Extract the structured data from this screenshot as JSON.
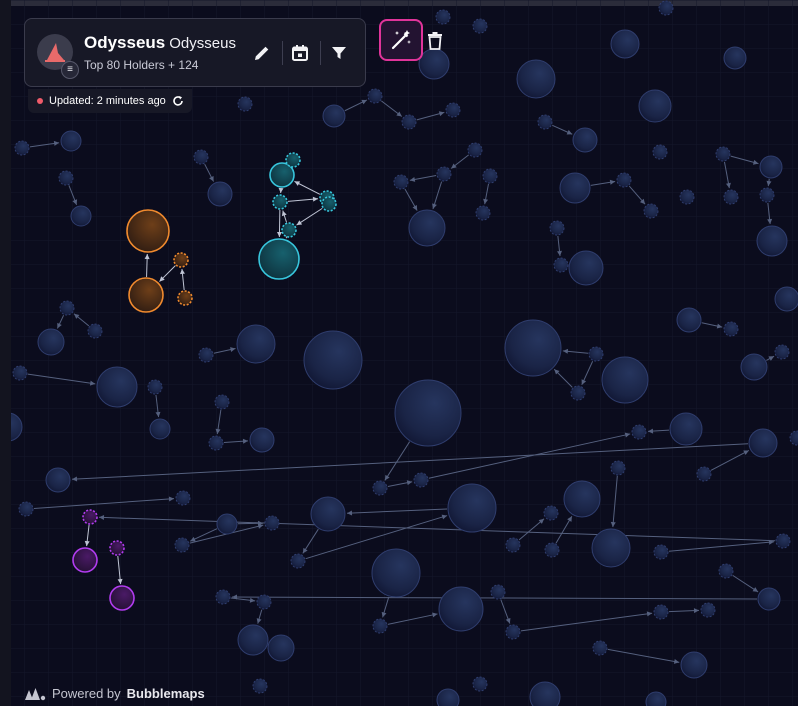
{
  "token": {
    "name": "Odysseus",
    "symbol": "Odysseus",
    "subtitle": "Top 80 Holders + 124",
    "logo_color": "#e86a6a"
  },
  "chain_icon": "solana-icon",
  "status": {
    "updated_text": "Updated: 2 minutes ago",
    "dot_color": "#ef5b6a"
  },
  "toolbar": {
    "edit_icon": "pencil-icon",
    "calendar_icon": "calendar-icon",
    "filter_icon": "filter-icon",
    "magic_icon": "magic-wand-icon",
    "delete_icon": "trash-icon"
  },
  "footer": {
    "powered_prefix": "Powered by",
    "brand": "Bubblemaps"
  },
  "colors": {
    "background": "#0b0c1d",
    "bubble_default": "#2a3a6a",
    "cluster_teal": "#38c6dd",
    "cluster_orange": "#f08a2e",
    "cluster_purple": "#b23cf0",
    "accent_magenta": "#e0349a"
  }
}
